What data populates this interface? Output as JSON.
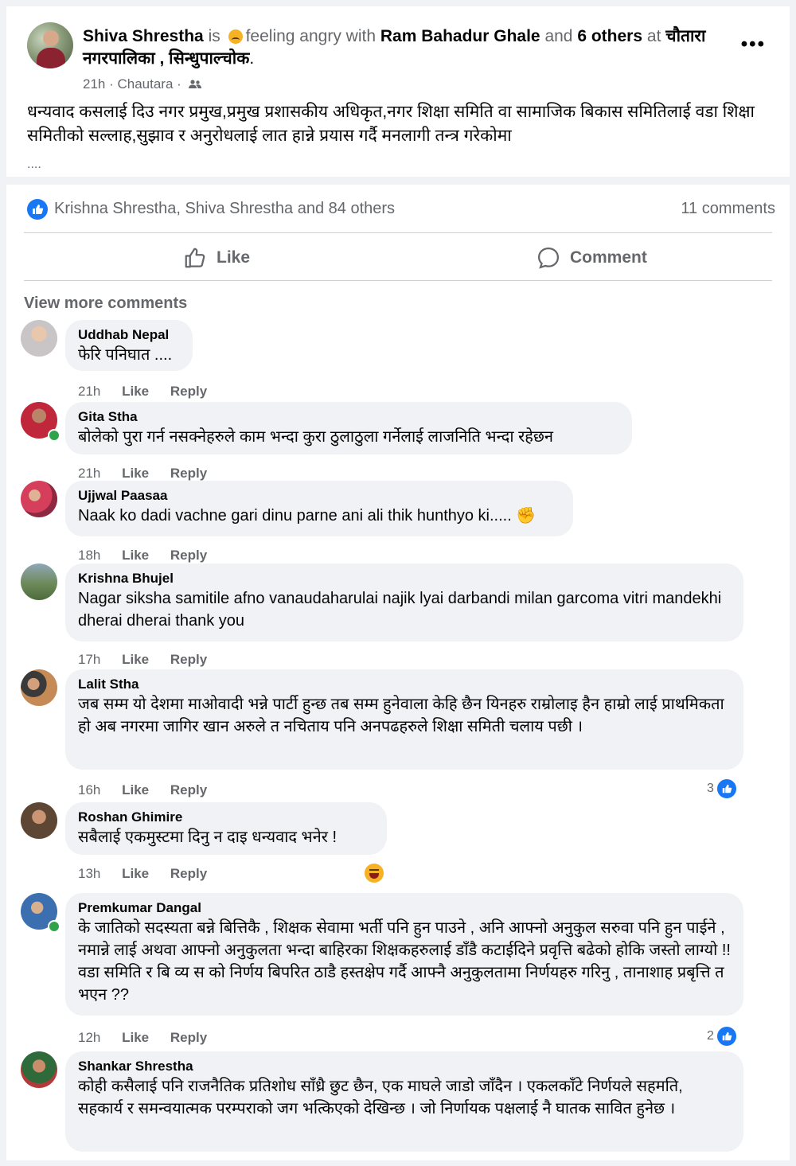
{
  "post": {
    "author": "Shiva Shrestha",
    "is_text": "is",
    "feeling": "feeling angry with",
    "tagged": "Ram Bahadur Ghale",
    "and_text": "and",
    "others": "6 others",
    "at_text": "at",
    "location": "चौतारा नगरपालिका , सिन्धुपाल्चोक",
    "period": ".",
    "time": "21h · Chautara ·",
    "body": "धन्यवाद कसलाई दिउ नगर प्रमुख,प्रमुख प्रशासकीय अधिकृत,नगर शिक्षा समिति वा सामाजिक बिकास समितिलाई वडा शिक्षा समितीको सल्लाह,सुझाव र अनुरोधलाई लात हान्ने प्रयास गर्दै मनलागी तन्त्र गरेकोमा",
    "ellipsis": "....",
    "more": "•••",
    "reactions_names": "Krishna Shrestha, Shiva Shrestha and 84 others",
    "comments_count": "11 comments",
    "like_label": "Like",
    "comment_label": "Comment",
    "view_more": "View more comments",
    "feeling_icon": "angry-face-icon",
    "audience_icon": "friends-icon"
  },
  "comments": [
    {
      "name": "Uddhab Nepal",
      "text": "फेरि पनिघात ....",
      "time": "21h",
      "like": "Like",
      "reply": "Reply"
    },
    {
      "name": "Gita Stha",
      "text": "बोलेको पुरा गर्न नसक्नेहरुले काम भन्दा कुरा ठुलाठुला गर्नेलाई लाजनिति भन्दा रहेछन",
      "time": "21h",
      "like": "Like",
      "reply": "Reply"
    },
    {
      "name": "Ujjwal Paasaa",
      "text": "Naak ko dadi vachne gari dinu parne ani ali thik hunthyo ki.....",
      "time": "18h",
      "like": "Like",
      "reply": "Reply"
    },
    {
      "name": "Krishna Bhujel",
      "text": "Nagar siksha samitile afno vanaudaharulai najik lyai darbandi milan garcoma vitri mandekhi dherai dherai thank you",
      "time": "17h",
      "like": "Like",
      "reply": "Reply"
    },
    {
      "name": "Lalit Stha",
      "text": "जब सम्म यो देशमा माओवादी भन्ने पार्टी हुन्छ तब सम्म हुनेवाला केहि छैन यिनहरु राम्रोलाइ हैन हाम्रो लाई प्राथमिकता हो अब नगरमा जागिर खान अरुले त नचिताय पनि अनपढहरुले शिक्षा समिती चलाय पछी ।",
      "time": "16h",
      "like": "Like",
      "reply": "Reply",
      "reactions": "3"
    },
    {
      "name": "Roshan Ghimire",
      "text": "सबैलाई एकमुस्टमा दिनु न दाइ धन्यवाद भनेर !",
      "time": "13h",
      "like": "Like",
      "reply": "Reply"
    },
    {
      "name": "Premkumar Dangal",
      "text": "के जातिको सदस्यता बन्ने बित्तिकै , शिक्षक सेवामा भर्ती पनि हुन पाउने , अनि आफ्नो अनुकुल सरुवा पनि हुन पाईने , नमान्ने लाई अथवा आफ्नो अनुकुलता भन्दा बाहिरका शिक्षकहरुलाई डाँडै कटाईदिने प्रवृत्ति बढेको होकि जस्तो लाग्यो !! वडा समिति र बि व्य स को निर्णय बिपरित ठाडै हस्तक्षेप गर्दै आफ्नै अनुकुलतामा निर्णयहरु गरिनु , तानाशाह प्रबृत्ति त भएन ??",
      "time": "12h",
      "like": "Like",
      "reply": "Reply",
      "reactions": "2"
    },
    {
      "name": "Shankar Shrestha",
      "text": "कोही कसैलाई पनि राजनैतिक प्रतिशोध साँध्रै छुट छैन, एक माघले जाडो जाँदैन । एकलकाँटे निर्णयले सहमति, सहकार्य र समन्वयात्मक परम्पराको जग भत्किएको देखिन्छ । जो निर्णायक पक्षलाई नै घातक सावित हुनेछ ।"
    }
  ]
}
